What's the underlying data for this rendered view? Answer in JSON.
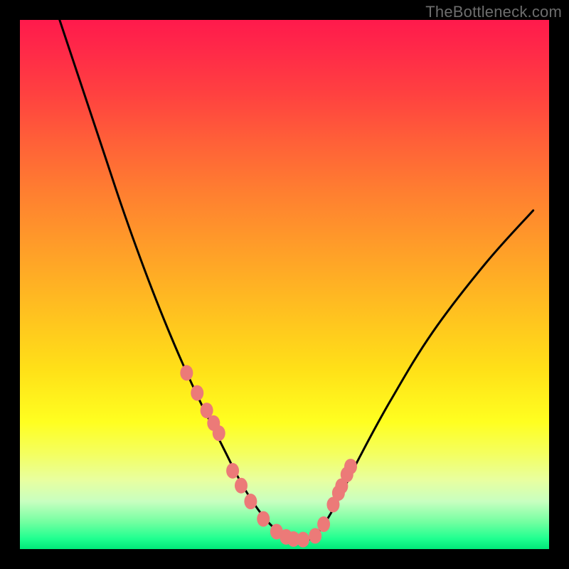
{
  "watermark": "TheBottleneck.com",
  "chart_data": {
    "type": "line",
    "title": "",
    "xlabel": "",
    "ylabel": "",
    "xlim": [
      0,
      100
    ],
    "ylim": [
      0,
      100
    ],
    "grid": false,
    "legend": false,
    "series": [
      {
        "name": "curve",
        "color": "#000000",
        "x": [
          7.5,
          10,
          13,
          16,
          19,
          22,
          25,
          28,
          31,
          34,
          36.5,
          39,
          41,
          43,
          45,
          47,
          49,
          51,
          53,
          55,
          57,
          60,
          64,
          70,
          78,
          88,
          97
        ],
        "values": [
          100,
          92.5,
          83.5,
          74.5,
          65.5,
          57,
          49,
          41.5,
          34.5,
          28,
          23,
          18,
          14,
          10.5,
          7.5,
          5,
          3.2,
          2,
          1.5,
          2,
          4,
          9,
          17,
          28,
          41,
          54,
          64
        ]
      }
    ],
    "markers": {
      "color": "#ec7a78",
      "x_pct": [
        31.5,
        33.5,
        35.3,
        36.6,
        37.6,
        40.2,
        41.8,
        43.6,
        46.0,
        48.5,
        50.3,
        51.7,
        53.5,
        55.8,
        57.4,
        59.2,
        60.2,
        60.8,
        61.8,
        62.5
      ],
      "y_pct": [
        33.3,
        29.5,
        26.2,
        23.8,
        21.9,
        14.8,
        12.0,
        9.0,
        5.7,
        3.3,
        2.3,
        1.9,
        1.8,
        2.5,
        4.7,
        8.4,
        10.6,
        11.9,
        14.1,
        15.6
      ]
    },
    "colors": {
      "gradient_top": "#ff1a4c",
      "gradient_mid": "#ffe018",
      "gradient_bottom": "#00e878",
      "marker": "#ec7a78",
      "curve": "#000000",
      "frame": "#000000"
    }
  }
}
